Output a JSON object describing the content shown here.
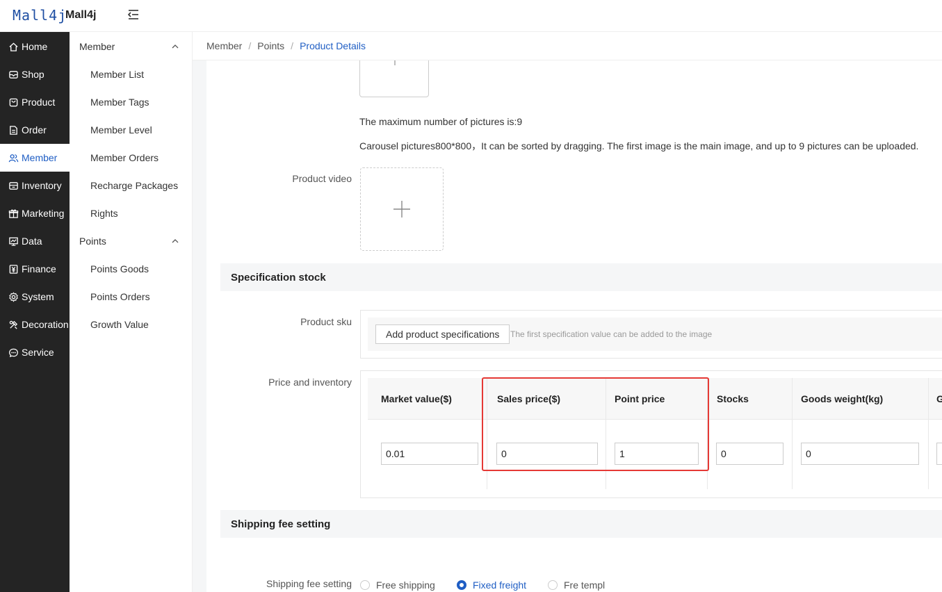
{
  "brand": {
    "logo": "Mall4j",
    "name": "Mall4j"
  },
  "nav": [
    {
      "label": "Home",
      "icon": "home-icon"
    },
    {
      "label": "Shop",
      "icon": "shop-icon"
    },
    {
      "label": "Product",
      "icon": "product-icon"
    },
    {
      "label": "Order",
      "icon": "order-icon"
    },
    {
      "label": "Member",
      "icon": "member-icon",
      "active": true
    },
    {
      "label": "Inventory",
      "icon": "inventory-icon"
    },
    {
      "label": "Marketing",
      "icon": "gift-icon"
    },
    {
      "label": "Data",
      "icon": "chart-icon"
    },
    {
      "label": "Finance",
      "icon": "finance-icon"
    },
    {
      "label": "System",
      "icon": "gear-icon"
    },
    {
      "label": "Decoration",
      "icon": "decoration-icon"
    },
    {
      "label": "Service",
      "icon": "chat-icon"
    }
  ],
  "subnav": {
    "member_group": "Member",
    "member_items": [
      "Member List",
      "Member Tags",
      "Member Level",
      "Member Orders",
      "Recharge Packages",
      "Rights"
    ],
    "points_group": "Points",
    "points_items": [
      "Points Goods",
      "Points Orders",
      "Growth Value"
    ]
  },
  "breadcrumb": {
    "a": "Member",
    "b": "Points",
    "c": "Product Details",
    "sep": "/"
  },
  "images": {
    "max_note": "The maximum number of pictures is:9",
    "carousel_note": "Carousel pictures800*800，It can be sorted by dragging. The first image is the main image, and up to 9 pictures can be uploaded."
  },
  "video": {
    "label": "Product video"
  },
  "spec": {
    "title": "Specification stock",
    "sku_label": "Product sku",
    "add_button": "Add product specifications",
    "hint": "The first specification value can be added to the image"
  },
  "price": {
    "label": "Price and inventory",
    "columns": [
      "Market value($)",
      "Sales price($)",
      "Point price",
      "Stocks",
      "Goods weight(kg)",
      "G"
    ],
    "values": [
      "0.01",
      "0",
      "1",
      "0",
      "0",
      ""
    ]
  },
  "shipping": {
    "title": "Shipping fee setting",
    "label": "Shipping fee setting",
    "options": [
      "Free shipping",
      "Fixed freight",
      "Fre templ"
    ],
    "selected": 1
  },
  "colors": {
    "accent": "#1f5ec4",
    "nav_bg": "#242424",
    "highlight": "#e53935"
  }
}
